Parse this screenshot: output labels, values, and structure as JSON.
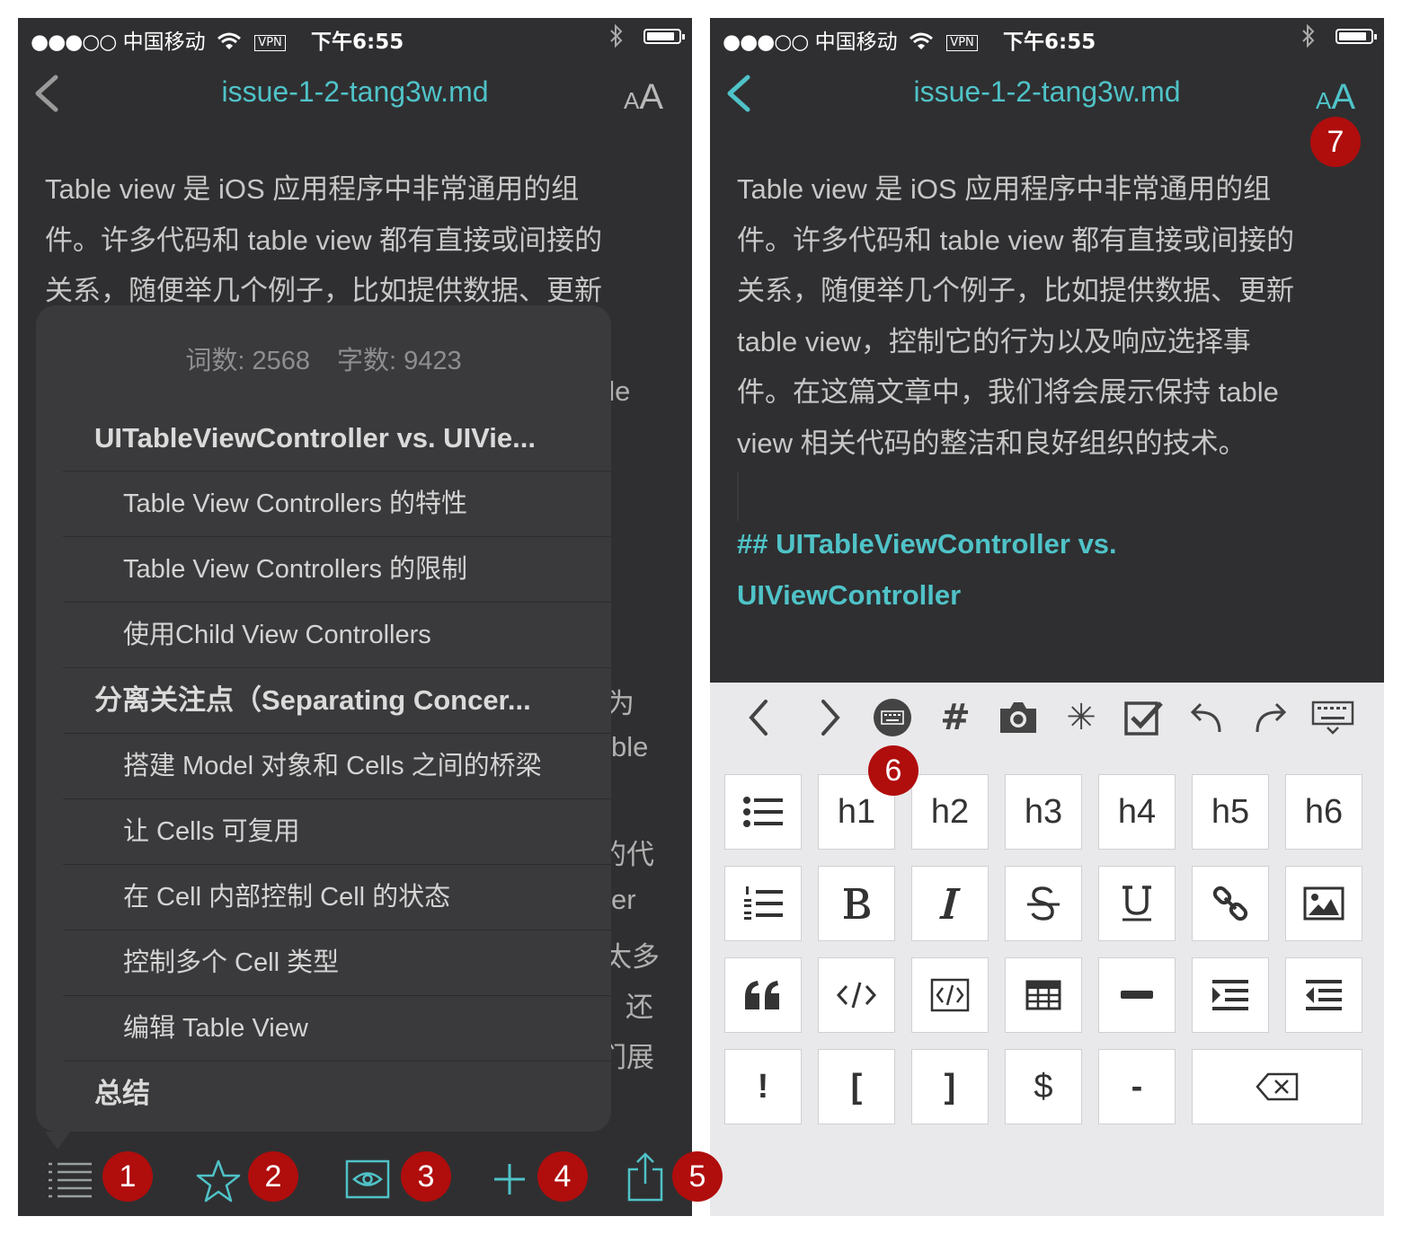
{
  "status_bar": {
    "signal": "●●●○○",
    "carrier": "中国移动",
    "vpn": "VPN",
    "time": "下午6:55"
  },
  "nav": {
    "title": "issue-1-2-tang3w.md",
    "font_small": "A",
    "font_big": "A"
  },
  "left": {
    "body_lines": [
      "Table view 是 iOS 应用程序中非常通用的组",
      "件。许多代码和 table view 都有直接或间接的",
      "关系，随便举几个例子，比如提供数据、更新"
    ],
    "behind_fragments": [
      "ble",
      "为",
      "ble",
      "的代",
      "er",
      "太多",
      "还",
      "们展"
    ],
    "outline": {
      "word_count": "词数: 2568",
      "char_count": "字数: 9423",
      "items": [
        {
          "level": 1,
          "text": "UITableViewController vs. UIVie..."
        },
        {
          "level": 2,
          "text": "Table View Controllers 的特性"
        },
        {
          "level": 2,
          "text": "Table View Controllers 的限制"
        },
        {
          "level": 2,
          "text": "使用Child View Controllers"
        },
        {
          "level": 1,
          "text": "分离关注点（Separating Concer..."
        },
        {
          "level": 2,
          "text": "搭建 Model 对象和 Cells 之间的桥梁"
        },
        {
          "level": 2,
          "text": "让 Cells 可复用"
        },
        {
          "level": 2,
          "text": "在 Cell 内部控制 Cell 的状态"
        },
        {
          "level": 2,
          "text": "控制多个 Cell 类型"
        },
        {
          "level": 2,
          "text": "编辑 Table View"
        },
        {
          "level": 1,
          "text": "总结"
        }
      ]
    },
    "toolbar_icons": [
      "outline-icon",
      "star-icon",
      "preview-eye-icon",
      "plus-icon",
      "share-icon"
    ],
    "badges": [
      "1",
      "2",
      "3",
      "4",
      "5"
    ]
  },
  "right": {
    "body_lines": [
      "Table view 是 iOS 应用程序中非常通用的组",
      "件。许多代码和 table view 都有直接或间接的",
      "关系，随便举几个例子，比如提供数据、更新",
      "table view，控制它的行为以及响应选择事",
      "件。在这篇文章中，我们将会展示保持 table",
      "view 相关代码的整洁和良好组织的技术。"
    ],
    "heading_lines": [
      "## UITableViewController vs.",
      "UIViewController"
    ],
    "badges": [
      "6",
      "7"
    ],
    "top_bar_glyphs": {
      "hash": "#",
      "asterisk": "✳"
    },
    "heading_keys": [
      "h1",
      "h2",
      "h3",
      "h4",
      "h5",
      "h6"
    ],
    "symbol_keys": [
      "!",
      "[",
      "]",
      "$",
      "-"
    ]
  },
  "colors": {
    "background": "#2f2f31",
    "accent": "#4fc3c8",
    "badge": "#b00d0d",
    "keyboard": "#e9e9eb"
  }
}
